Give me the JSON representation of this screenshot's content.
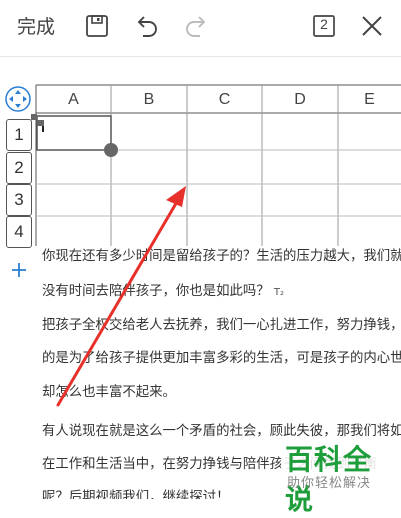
{
  "toolbar": {
    "done_label": "完成",
    "page_count": "2",
    "icons": [
      "save-icon",
      "undo-icon",
      "redo-icon",
      "page-count-icon",
      "close-icon"
    ]
  },
  "sheet": {
    "columns": [
      "A",
      "B",
      "C",
      "D",
      "E"
    ],
    "rows": [
      "1",
      "2",
      "3",
      "4"
    ]
  },
  "doc": {
    "lines": [
      "你现在还有多少时间是留给孩子的？生活的压力越大，我们就越",
      "没有时间去陪伴孩子，你也是如此吗？",
      "把孩子全权交给老人去抚养，我们一心扎进工作，努力挣钱，目",
      "的是为了给孩子提供更加丰富多彩的生活，可是孩子的内心世界",
      "却怎么也丰富不起来。",
      "有人说现在就是这么一个矛盾的社会，顾此失彼，那我们将如何",
      "在工作和生活当中，在努力挣钱与陪伴孩子之间找到平衡",
      "呢？后期视频我们，继续探讨！"
    ],
    "subscript": "T₂"
  },
  "watermark": {
    "title": "百科全说",
    "subtitle": "助你轻松解决"
  },
  "colors": {
    "arrow": "#e8302a",
    "watermark_green": "#1e9e3a",
    "accent_blue": "#2a7fd4"
  }
}
